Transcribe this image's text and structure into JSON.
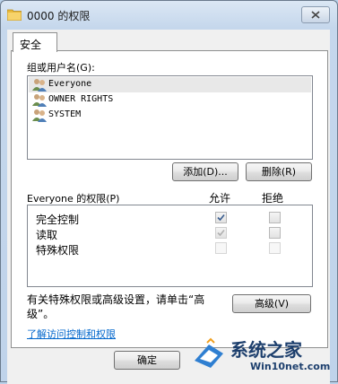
{
  "window": {
    "title": "0000 的权限"
  },
  "tabs": [
    {
      "label": "安全"
    }
  ],
  "groups": {
    "label": "组或用户名(G):",
    "users": [
      {
        "name": "Everyone",
        "selected": true
      },
      {
        "name": "OWNER RIGHTS",
        "selected": false
      },
      {
        "name": "SYSTEM",
        "selected": false
      }
    ],
    "add_button": "添加(D)...",
    "remove_button": "删除(R)"
  },
  "permissions": {
    "label": "Everyone 的权限(P)",
    "allow_header": "允许",
    "deny_header": "拒绝",
    "rows": [
      {
        "name": "完全控制",
        "allow": true,
        "allow_disabled": false,
        "deny": false
      },
      {
        "name": "读取",
        "allow": true,
        "allow_disabled": true,
        "deny": false
      },
      {
        "name": "特殊权限",
        "allow": false,
        "allow_disabled": true,
        "deny": false
      }
    ]
  },
  "advanced": {
    "text_line1": "有关特殊权限或高级设置，请单击“高",
    "text_line2": "级”。",
    "button": "高级(V)"
  },
  "link": "了解访问控制和权限",
  "footer": {
    "ok_button": "确定"
  },
  "watermark": {
    "title": "系统之家",
    "subtitle": "Win10net.com"
  }
}
